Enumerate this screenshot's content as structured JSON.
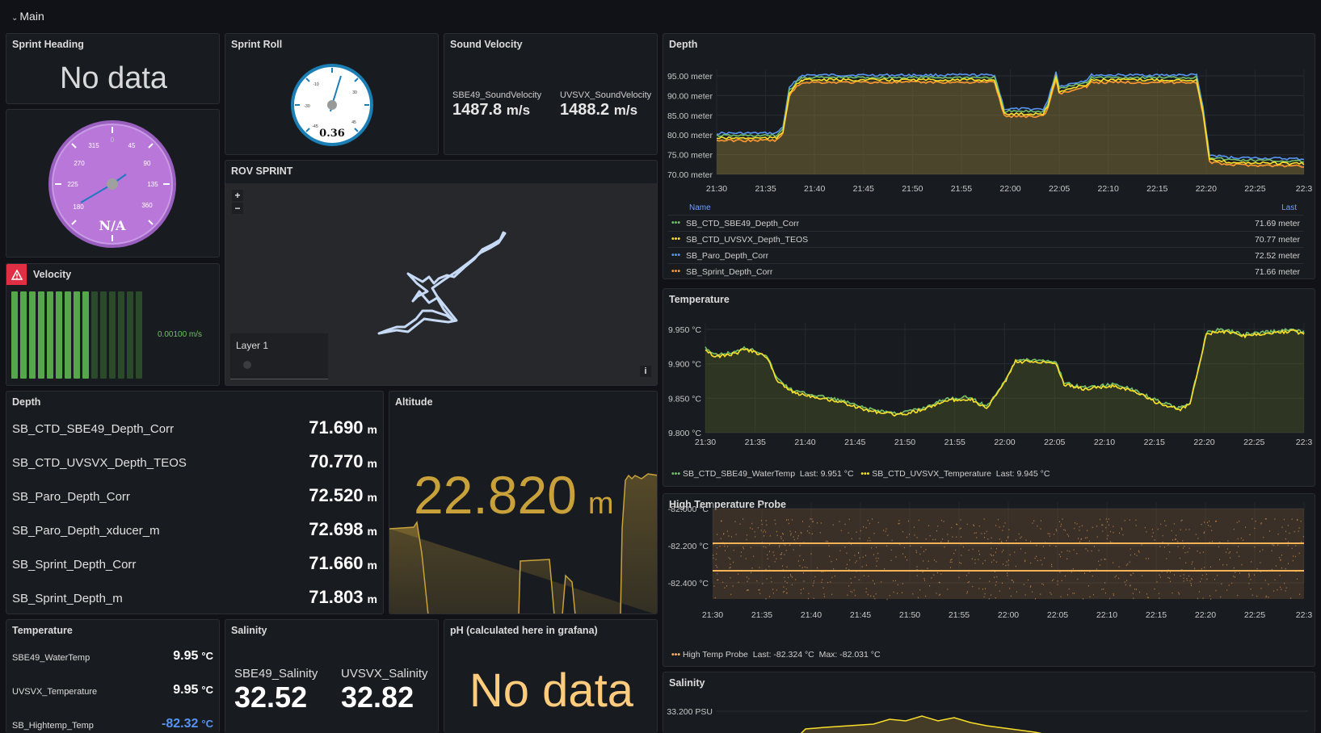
{
  "row": {
    "chevron": "⌄",
    "title": "Main"
  },
  "sprint_heading": {
    "title": "Sprint Heading",
    "value": "No data"
  },
  "heading_gauge": {
    "ticks": [
      "0",
      "45",
      "90",
      "135",
      "360",
      "180",
      "225",
      "270",
      "315"
    ],
    "label": "N/A"
  },
  "sprint_roll": {
    "title": "Sprint Roll",
    "value": "0.36",
    "ticks": [
      "-10",
      "-30",
      "-45",
      "30",
      "45"
    ]
  },
  "sound_velocity": {
    "title": "Sound Velocity",
    "items": [
      {
        "name": "SBE49_SoundVelocity",
        "value": "1487.8",
        "unit": "m/s"
      },
      {
        "name": "UVSVX_SoundVelocity",
        "value": "1488.2",
        "unit": "m/s"
      }
    ]
  },
  "velocity": {
    "title": "Velocity",
    "value": "0.00100 m/s",
    "lit_bars": 9,
    "total_bars": 15
  },
  "rov_map": {
    "title": "ROV SPRINT",
    "zoom_in": "+",
    "zoom_out": "−",
    "layer": "Layer 1",
    "info": "i"
  },
  "depth_stats": {
    "title": "Depth",
    "unit": "m",
    "rows": [
      {
        "name": "SB_CTD_SBE49_Depth_Corr",
        "value": "71.690"
      },
      {
        "name": "SB_CTD_UVSVX_Depth_TEOS",
        "value": "70.770"
      },
      {
        "name": "SB_Paro_Depth_Corr",
        "value": "72.520"
      },
      {
        "name": "SB_Paro_Depth_xducer_m",
        "value": "72.698"
      },
      {
        "name": "SB_Sprint_Depth_Corr",
        "value": "71.660"
      },
      {
        "name": "SB_Sprint_Depth_m",
        "value": "71.803"
      }
    ]
  },
  "altitude": {
    "title": "Altitude",
    "value": "22.820",
    "unit": "m"
  },
  "temperature_stats": {
    "title": "Temperature",
    "rows": [
      {
        "name": "SBE49_WaterTemp",
        "value": "9.95",
        "unit": "°C"
      },
      {
        "name": "UVSVX_Temperature",
        "value": "9.95",
        "unit": "°C"
      },
      {
        "name": "SB_Hightemp_Temp",
        "value": "-82.32",
        "unit": "°C"
      }
    ]
  },
  "salinity_stats": {
    "title": "Salinity",
    "items": [
      {
        "name": "SBE49_Salinity",
        "value": "32.52"
      },
      {
        "name": "UVSVX_Salinity",
        "value": "32.82"
      }
    ]
  },
  "ph": {
    "title": "pH (calculated here in grafana)",
    "value": "No data"
  },
  "time_ticks": [
    "21:30",
    "21:35",
    "21:40",
    "21:45",
    "21:50",
    "21:55",
    "22:00",
    "22:05",
    "22:10",
    "22:15",
    "22:20",
    "22:25",
    "22:3"
  ],
  "depth_chart": {
    "title": "Depth",
    "yticks": [
      "95.00 meter",
      "90.00 meter",
      "85.00 meter",
      "80.00 meter",
      "75.00 meter",
      "70.00 meter"
    ],
    "legend_header": {
      "name": "Name",
      "last": "Last"
    },
    "legend": [
      {
        "name": "SB_CTD_SBE49_Depth_Corr",
        "last": "71.69 meter",
        "color": "#73bf69"
      },
      {
        "name": "SB_CTD_UVSVX_Depth_TEOS",
        "last": "70.77 meter",
        "color": "#fade2a"
      },
      {
        "name": "SB_Paro_Depth_Corr",
        "last": "72.52 meter",
        "color": "#5794f2"
      },
      {
        "name": "SB_Sprint_Depth_Corr",
        "last": "71.66 meter",
        "color": "#ff9830"
      }
    ]
  },
  "temperature_chart": {
    "title": "Temperature",
    "yticks": [
      "9.950 °C",
      "9.900 °C",
      "9.850 °C",
      "9.800 °C"
    ],
    "legend": [
      {
        "name": "SB_CTD_SBE49_WaterTemp",
        "stat": "Last: 9.951 °C",
        "color": "#73bf69"
      },
      {
        "name": "SB_CTD_UVSVX_Temperature",
        "stat": "Last: 9.945 °C",
        "color": "#fade2a"
      }
    ]
  },
  "hightemp_chart": {
    "title": "High Temperature Probe",
    "yticks": [
      "-82.000 °C",
      "-82.200 °C",
      "-82.400 °C"
    ],
    "legend": {
      "name": "High Temp Probe",
      "last": "Last: -82.324 °C",
      "max": "Max: -82.031 °C",
      "color": "#ffb357"
    }
  },
  "salinity_chart": {
    "title": "Salinity",
    "ytick": "33.200 PSU"
  },
  "colors": {
    "green": "#73bf69",
    "yellow": "#fade2a",
    "blue": "#5794f2",
    "orange": "#ff9830",
    "gold": "#c9a13b",
    "alert": "#e02f44",
    "purple": "#b877d9"
  }
}
